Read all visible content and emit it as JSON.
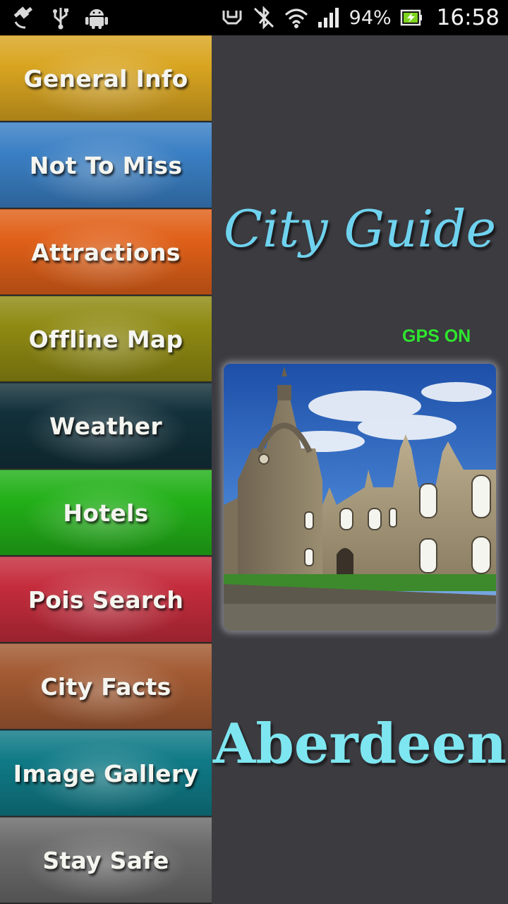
{
  "status_bar": {
    "battery": "94%",
    "time": "16:58",
    "icons": [
      "gps-icon",
      "usb-icon",
      "android-icon",
      "vibrate-icon",
      "bluetooth-icon",
      "wifi-icon",
      "signal-icon",
      "battery-icon"
    ]
  },
  "menu": {
    "items": [
      {
        "label": "General Info",
        "color": "#d9a520"
      },
      {
        "label": "Not To Miss",
        "color": "#3a7fc4"
      },
      {
        "label": "Attractions",
        "color": "#e06018"
      },
      {
        "label": "Offline Map",
        "color": "#8f8a12"
      },
      {
        "label": "Weather",
        "color": "#12303a"
      },
      {
        "label": "Hotels",
        "color": "#22b018"
      },
      {
        "label": "Pois Search",
        "color": "#c42c3c"
      },
      {
        "label": "City Facts",
        "color": "#a25a32"
      },
      {
        "label": "Image Gallery",
        "color": "#0f7a86"
      },
      {
        "label": "Stay Safe",
        "color": "#6a6a6a"
      }
    ]
  },
  "panel": {
    "title": "City Guide",
    "gps_status": "GPS ON",
    "city": "Aberdeen",
    "title_color": "#6fd3ef",
    "gps_color": "#2ee62e",
    "city_color": "#7ee6f0"
  }
}
